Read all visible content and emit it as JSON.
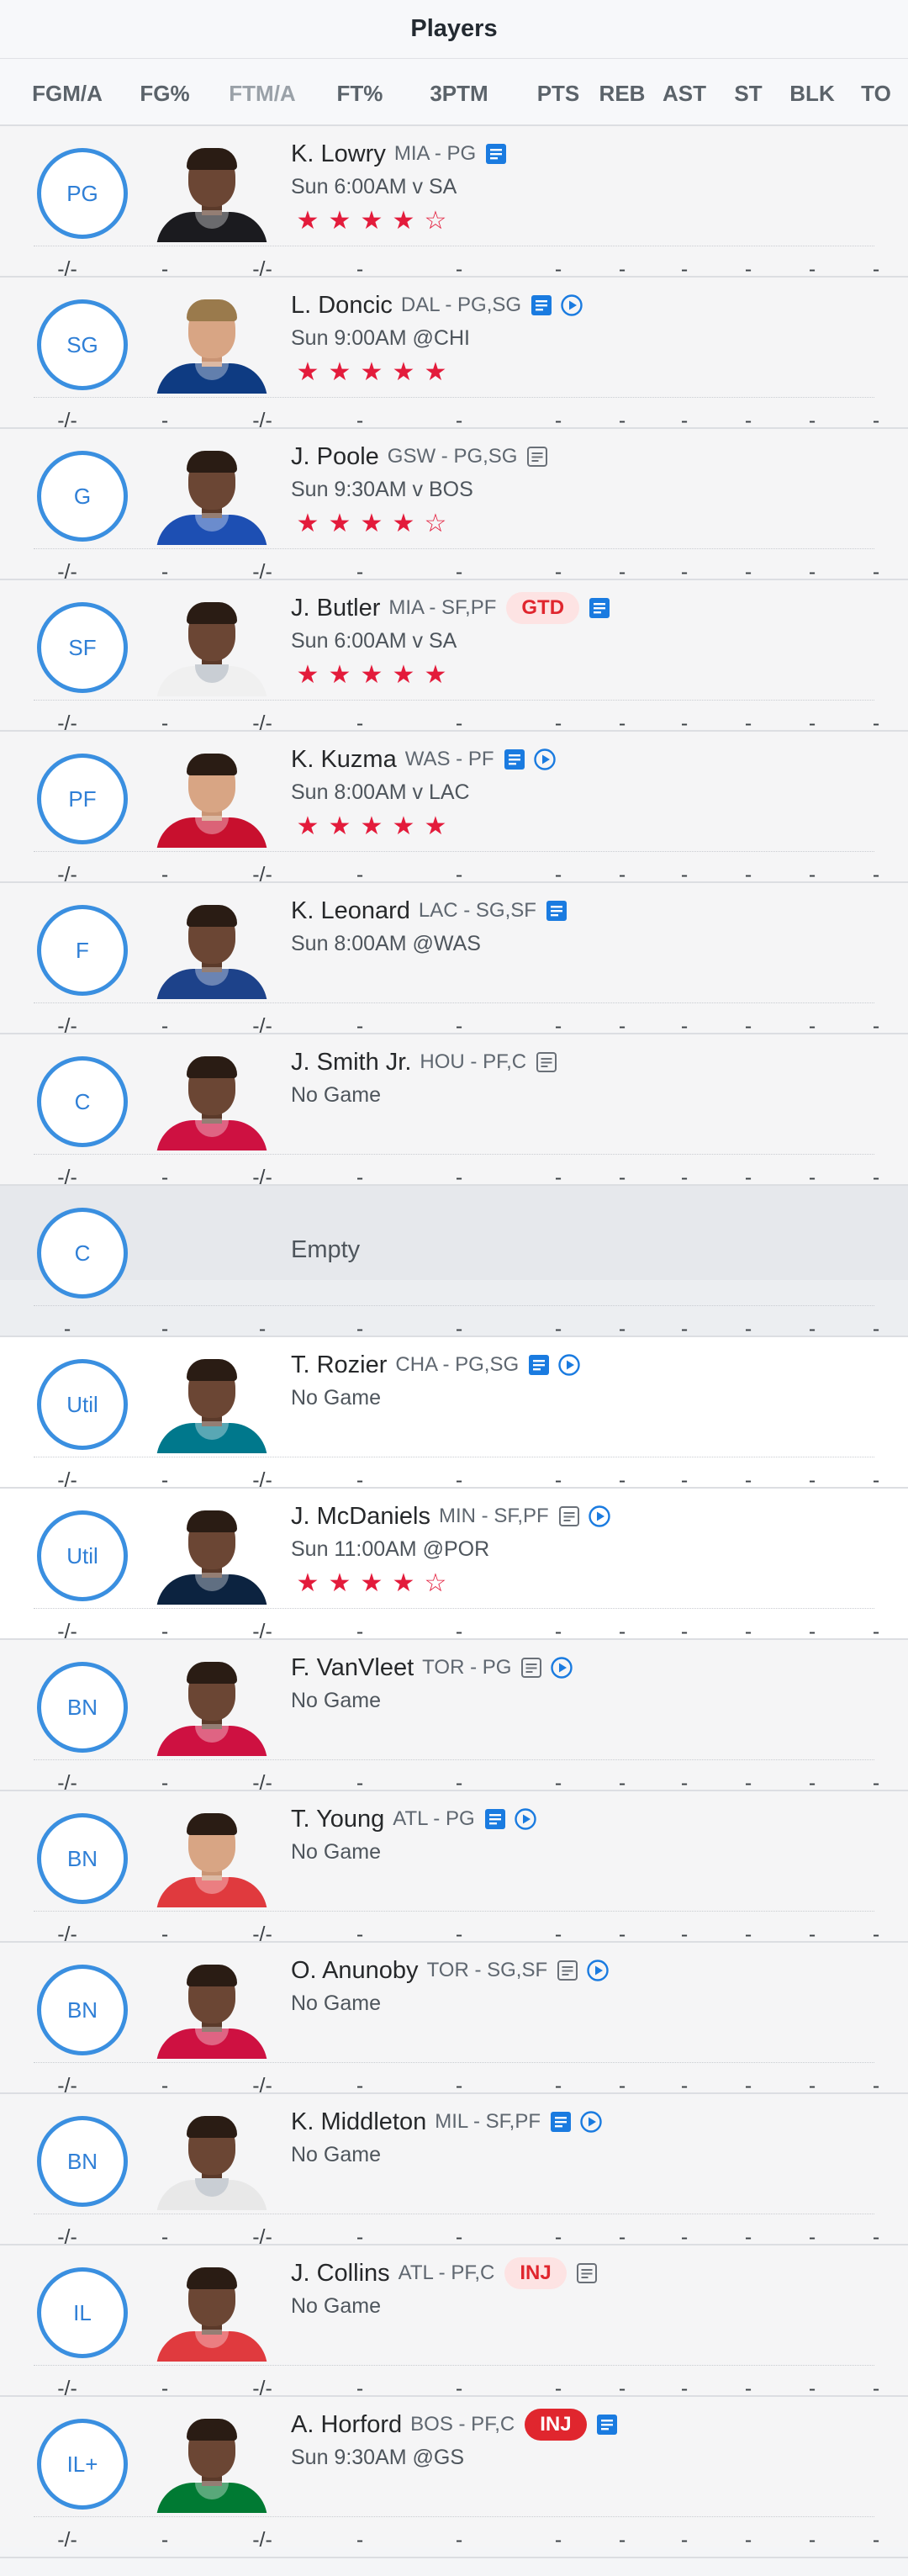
{
  "header": {
    "title": "Players"
  },
  "columns": [
    "FGM/A",
    "FG%",
    "FTM/A",
    "FT%",
    "3PTM",
    "PTS",
    "REB",
    "AST",
    "ST",
    "BLK",
    "TO"
  ],
  "colors": {
    "accent": "#3a8fe0",
    "star": "#e31b3b",
    "injury": "#e0262e",
    "note_blue": "#1a7be0"
  },
  "rows": [
    {
      "slot": "PG",
      "name": "K. Lowry",
      "team": "MIA - PG",
      "badge": "",
      "note": "blue",
      "video": false,
      "game": "Sun 6:00AM v SA",
      "rating": 4,
      "stars": [
        "★",
        "★",
        "★",
        "★",
        "☆"
      ],
      "stats": [
        "-/-",
        "-",
        "-/-",
        "-",
        "-",
        "-",
        "-",
        "-",
        "-",
        "-",
        "-"
      ],
      "jersey": "#1b1b1f",
      "skin": "dark"
    },
    {
      "slot": "SG",
      "name": "L. Doncic",
      "team": "DAL - PG,SG",
      "badge": "",
      "note": "blue",
      "video": true,
      "game": "Sun 9:00AM @CHI",
      "rating": 5,
      "stars": [
        "★",
        "★",
        "★",
        "★",
        "★"
      ],
      "stats": [
        "-/-",
        "-",
        "-/-",
        "-",
        "-",
        "-",
        "-",
        "-",
        "-",
        "-",
        "-"
      ],
      "jersey": "#0e3b82",
      "skin": "light"
    },
    {
      "slot": "G",
      "name": "J. Poole",
      "team": "GSW - PG,SG",
      "badge": "",
      "note": "gray",
      "video": false,
      "game": "Sun 9:30AM v BOS",
      "rating": 4,
      "stars": [
        "★",
        "★",
        "★",
        "★",
        "☆"
      ],
      "stats": [
        "-/-",
        "-",
        "-/-",
        "-",
        "-",
        "-",
        "-",
        "-",
        "-",
        "-",
        "-"
      ],
      "jersey": "#1d4fb3",
      "skin": "dark"
    },
    {
      "slot": "SF",
      "name": "J. Butler",
      "team": "MIA - SF,PF",
      "badge": "GTD",
      "note": "blue",
      "video": false,
      "game": "Sun 6:00AM v SA",
      "rating": 5,
      "stars": [
        "★",
        "★",
        "★",
        "★",
        "★"
      ],
      "stats": [
        "-/-",
        "-",
        "-/-",
        "-",
        "-",
        "-",
        "-",
        "-",
        "-",
        "-",
        "-"
      ],
      "jersey": "#f0f0f0",
      "skin": "dark"
    },
    {
      "slot": "PF",
      "name": "K. Kuzma",
      "team": "WAS - PF",
      "badge": "",
      "note": "blue",
      "video": true,
      "game": "Sun 8:00AM v LAC",
      "rating": 5,
      "stars": [
        "★",
        "★",
        "★",
        "★",
        "★"
      ],
      "stats": [
        "-/-",
        "-",
        "-/-",
        "-",
        "-",
        "-",
        "-",
        "-",
        "-",
        "-",
        "-"
      ],
      "jersey": "#c8102e",
      "skin": "light"
    },
    {
      "slot": "F",
      "name": "K. Leonard",
      "team": "LAC - SG,SF",
      "badge": "",
      "note": "blue",
      "video": false,
      "game": "Sun 8:00AM @WAS",
      "rating": 0,
      "stars": [],
      "stats": [
        "-/-",
        "-",
        "-/-",
        "-",
        "-",
        "-",
        "-",
        "-",
        "-",
        "-",
        "-"
      ],
      "jersey": "#1d428a",
      "skin": "dark"
    },
    {
      "slot": "C",
      "name": "J. Smith Jr.",
      "team": "HOU - PF,C",
      "badge": "",
      "note": "gray",
      "video": false,
      "game": "No Game",
      "rating": 0,
      "stars": [],
      "stats": [
        "-/-",
        "-",
        "-/-",
        "-",
        "-",
        "-",
        "-",
        "-",
        "-",
        "-",
        "-"
      ],
      "jersey": "#ce1141",
      "skin": "dark"
    },
    {
      "slot": "C",
      "name": "",
      "empty_label": "Empty",
      "empty": true,
      "stats": [
        "-",
        "-",
        "-",
        "-",
        "-",
        "-",
        "-",
        "-",
        "-",
        "-",
        "-"
      ]
    },
    {
      "slot": "Util",
      "name": "T. Rozier",
      "team": "CHA - PG,SG",
      "badge": "",
      "note": "blue",
      "video": true,
      "game": "No Game",
      "rating": 0,
      "stars": [],
      "stats": [
        "-/-",
        "-",
        "-/-",
        "-",
        "-",
        "-",
        "-",
        "-",
        "-",
        "-",
        "-"
      ],
      "jersey": "#00788c",
      "skin": "dark",
      "util": true
    },
    {
      "slot": "Util",
      "name": "J. McDaniels",
      "team": "MIN - SF,PF",
      "badge": "",
      "note": "gray",
      "video": true,
      "game": "Sun 11:00AM @POR",
      "rating": 4,
      "stars": [
        "★",
        "★",
        "★",
        "★",
        "☆"
      ],
      "stats": [
        "-/-",
        "-",
        "-/-",
        "-",
        "-",
        "-",
        "-",
        "-",
        "-",
        "-",
        "-"
      ],
      "jersey": "#0c2340",
      "skin": "dark",
      "util": true
    },
    {
      "slot": "BN",
      "name": "F. VanVleet",
      "team": "TOR - PG",
      "badge": "",
      "note": "gray",
      "video": true,
      "game": "No Game",
      "rating": 0,
      "stars": [],
      "stats": [
        "-/-",
        "-",
        "-/-",
        "-",
        "-",
        "-",
        "-",
        "-",
        "-",
        "-",
        "-"
      ],
      "jersey": "#ce1141",
      "skin": "dark"
    },
    {
      "slot": "BN",
      "name": "T. Young",
      "team": "ATL - PG",
      "badge": "",
      "note": "blue",
      "video": true,
      "game": "No Game",
      "rating": 0,
      "stars": [],
      "stats": [
        "-/-",
        "-",
        "-/-",
        "-",
        "-",
        "-",
        "-",
        "-",
        "-",
        "-",
        "-"
      ],
      "jersey": "#e03a3e",
      "skin": "light"
    },
    {
      "slot": "BN",
      "name": "O. Anunoby",
      "team": "TOR - SG,SF",
      "badge": "",
      "note": "gray",
      "video": true,
      "game": "No Game",
      "rating": 0,
      "stars": [],
      "stats": [
        "-/-",
        "-",
        "-/-",
        "-",
        "-",
        "-",
        "-",
        "-",
        "-",
        "-",
        "-"
      ],
      "jersey": "#ce1141",
      "skin": "dark"
    },
    {
      "slot": "BN",
      "name": "K. Middleton",
      "team": "MIL - SF,PF",
      "badge": "",
      "note": "blue",
      "video": true,
      "game": "No Game",
      "rating": 0,
      "stars": [],
      "stats": [
        "-/-",
        "-",
        "-/-",
        "-",
        "-",
        "-",
        "-",
        "-",
        "-",
        "-",
        "-"
      ],
      "jersey": "#e8e8e8",
      "skin": "dark"
    },
    {
      "slot": "IL",
      "name": "J. Collins",
      "team": "ATL - PF,C",
      "badge": "INJ",
      "badge_style": "light",
      "note": "gray",
      "video": false,
      "game": "No Game",
      "rating": 0,
      "stars": [],
      "stats": [
        "-/-",
        "-",
        "-/-",
        "-",
        "-",
        "-",
        "-",
        "-",
        "-",
        "-",
        "-"
      ],
      "jersey": "#e03a3e",
      "skin": "dark"
    },
    {
      "slot": "IL+",
      "name": "A. Horford",
      "team": "BOS - PF,C",
      "badge": "INJ",
      "badge_style": "solid",
      "note": "blue",
      "video": false,
      "game": "Sun 9:30AM @GS",
      "rating": 0,
      "stars": [],
      "stats": [
        "-/-",
        "-",
        "-/-",
        "-",
        "-",
        "-",
        "-",
        "-",
        "-",
        "-",
        "-"
      ],
      "jersey": "#007a33",
      "skin": "dark"
    }
  ]
}
